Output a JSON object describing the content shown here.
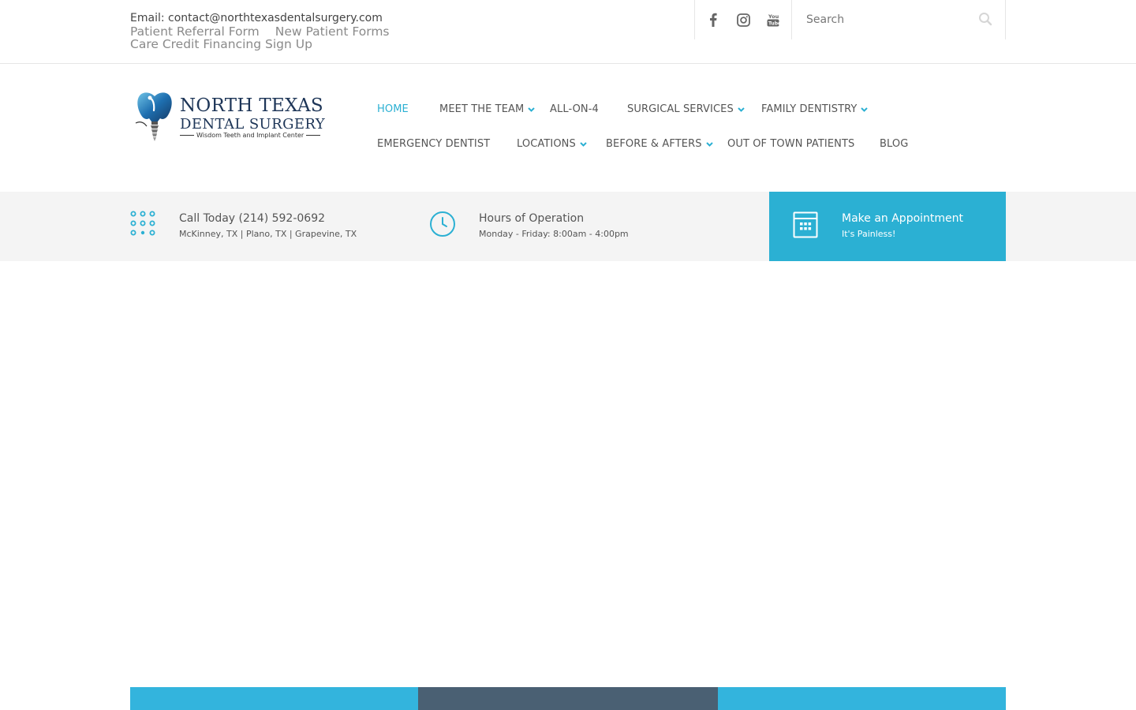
{
  "topbar": {
    "email": "Email: contact@northtexasdentalsurgery.com",
    "links": [
      "Patient Referral Form",
      "New Patient Forms",
      "Care Credit Financing Sign Up"
    ],
    "social": [
      "facebook-icon",
      "instagram-icon",
      "youtube-icon"
    ],
    "search": {
      "placeholder": "Search"
    }
  },
  "logo": {
    "line1": "NORTH TEXAS",
    "line2": "DENTAL SURGERY",
    "tagline": "Wisdom Teeth and Implant Center"
  },
  "nav": {
    "items": [
      {
        "label": "HOME",
        "active": true,
        "dropdown": false
      },
      {
        "label": "MEET THE TEAM",
        "active": false,
        "dropdown": true
      },
      {
        "label": "ALL-ON-4",
        "active": false,
        "dropdown": false
      },
      {
        "label": "SURGICAL SERVICES",
        "active": false,
        "dropdown": true
      },
      {
        "label": "FAMILY DENTISTRY",
        "active": false,
        "dropdown": true
      },
      {
        "label": "EMERGENCY DENTIST",
        "active": false,
        "dropdown": false
      },
      {
        "label": "LOCATIONS",
        "active": false,
        "dropdown": true
      },
      {
        "label": "BEFORE & AFTERS",
        "active": false,
        "dropdown": true
      },
      {
        "label": "OUT OF TOWN PATIENTS",
        "active": false,
        "dropdown": false
      },
      {
        "label": "BLOG",
        "active": false,
        "dropdown": false
      }
    ]
  },
  "infobar": {
    "call": {
      "title": "Call Today (214) 592-0692",
      "sub": "McKinney, TX  |  Plano, TX  |  Grapevine, TX"
    },
    "hours": {
      "title": "Hours of Operation",
      "sub": "Monday - Friday: 8:00am - 4:00pm"
    },
    "appointment": {
      "title": "Make an Appointment",
      "sub": "It's Painless!"
    }
  },
  "colors": {
    "accent": "#2bb0d3",
    "brand_navy": "#1d3557",
    "strip_blue": "#33b4dd",
    "strip_slate": "#4a6073",
    "infobar_bg": "#f4f4f4"
  }
}
